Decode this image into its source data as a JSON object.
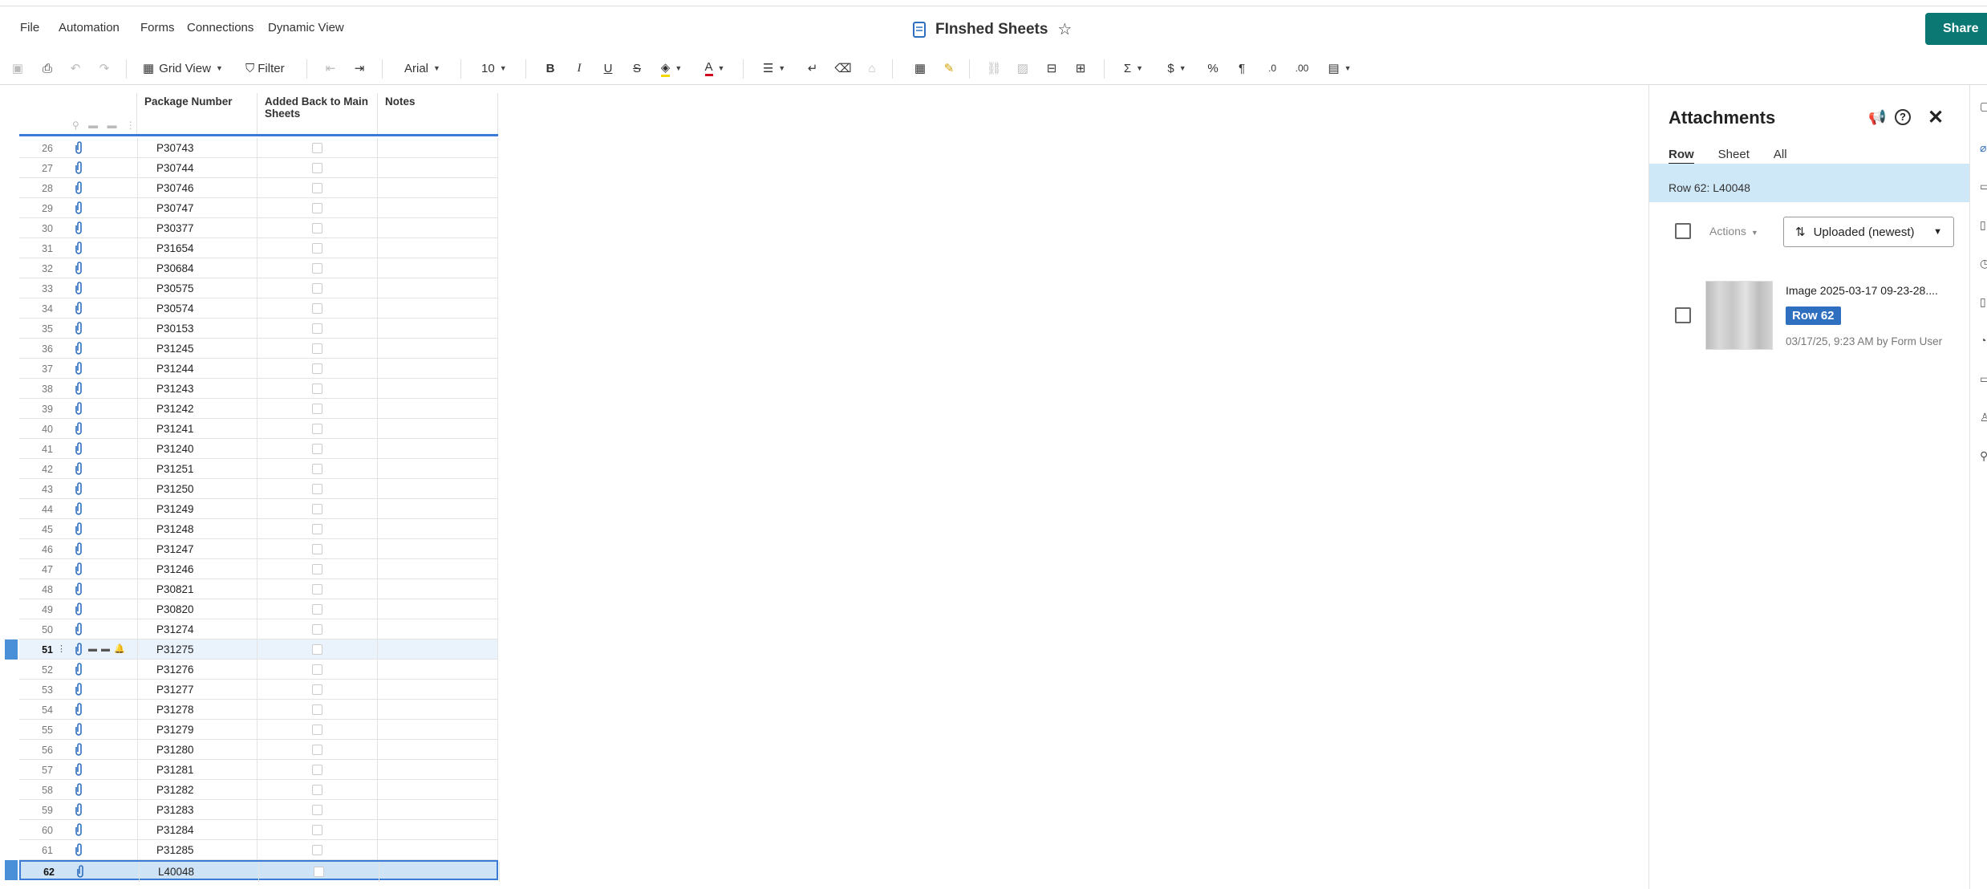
{
  "menu": {
    "file": "File",
    "automation": "Automation",
    "forms": "Forms",
    "connections": "Connections",
    "dynamic_view": "Dynamic View"
  },
  "sheet_title": "FInshed Sheets",
  "share_label": "Share",
  "toolbar": {
    "view": "Grid View",
    "filter": "Filter",
    "font": "Arial",
    "font_size": "10",
    "bold": "B",
    "italic": "I",
    "underline": "U",
    "strike": "S",
    "text_color": "A",
    "sum": "Σ",
    "currency": "$",
    "percent": "%",
    "para": "¶",
    "dec_less": ".0",
    "dec_more": ".00"
  },
  "columns": {
    "package": "Package Number",
    "added": "Added Back to Main Sheets",
    "notes": "Notes"
  },
  "rows": [
    {
      "num": "26",
      "pkg": "P30743"
    },
    {
      "num": "27",
      "pkg": "P30744"
    },
    {
      "num": "28",
      "pkg": "P30746"
    },
    {
      "num": "29",
      "pkg": "P30747"
    },
    {
      "num": "30",
      "pkg": "P30377"
    },
    {
      "num": "31",
      "pkg": "P31654"
    },
    {
      "num": "32",
      "pkg": "P30684"
    },
    {
      "num": "33",
      "pkg": "P30575"
    },
    {
      "num": "34",
      "pkg": "P30574"
    },
    {
      "num": "35",
      "pkg": "P30153"
    },
    {
      "num": "36",
      "pkg": "P31245"
    },
    {
      "num": "37",
      "pkg": "P31244"
    },
    {
      "num": "38",
      "pkg": "P31243"
    },
    {
      "num": "39",
      "pkg": "P31242"
    },
    {
      "num": "40",
      "pkg": "P31241"
    },
    {
      "num": "41",
      "pkg": "P31240"
    },
    {
      "num": "42",
      "pkg": "P31251"
    },
    {
      "num": "43",
      "pkg": "P31250"
    },
    {
      "num": "44",
      "pkg": "P31249"
    },
    {
      "num": "45",
      "pkg": "P31248"
    },
    {
      "num": "46",
      "pkg": "P31247"
    },
    {
      "num": "47",
      "pkg": "P31246"
    },
    {
      "num": "48",
      "pkg": "P30821"
    },
    {
      "num": "49",
      "pkg": "P30820"
    },
    {
      "num": "50",
      "pkg": "P31274"
    },
    {
      "num": "51",
      "pkg": "P31275"
    },
    {
      "num": "52",
      "pkg": "P31276"
    },
    {
      "num": "53",
      "pkg": "P31277"
    },
    {
      "num": "54",
      "pkg": "P31278"
    },
    {
      "num": "55",
      "pkg": "P31279"
    },
    {
      "num": "56",
      "pkg": "P31280"
    },
    {
      "num": "57",
      "pkg": "P31281"
    },
    {
      "num": "58",
      "pkg": "P31282"
    },
    {
      "num": "59",
      "pkg": "P31283"
    },
    {
      "num": "60",
      "pkg": "P31284"
    },
    {
      "num": "61",
      "pkg": "P31285"
    },
    {
      "num": "62",
      "pkg": "L40048"
    }
  ],
  "attachments": {
    "title": "Attachments",
    "tabs": [
      "Row",
      "Sheet",
      "All"
    ],
    "row_context": "Row 62: L40048",
    "actions_label": "Actions",
    "sort_label": "Uploaded (newest)",
    "item": {
      "name": "Image 2025-03-17 09-23-28....",
      "badge": "Row 62",
      "meta": "03/17/25, 9:23 AM by Form User"
    }
  },
  "colors": {
    "accent": "#0b7873",
    "selection": "#3a7bd5",
    "badge": "#2f6fc0"
  }
}
